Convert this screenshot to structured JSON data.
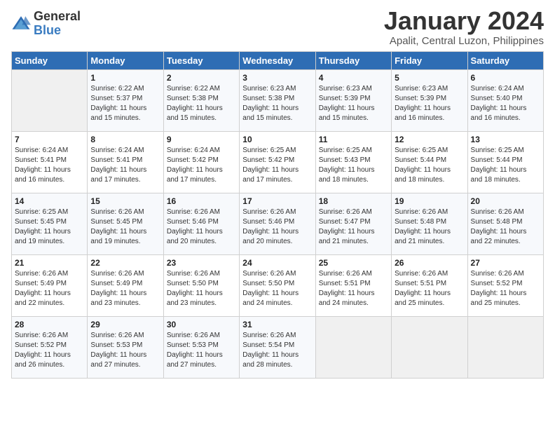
{
  "logo": {
    "general": "General",
    "blue": "Blue"
  },
  "calendar": {
    "title": "January 2024",
    "subtitle": "Apalit, Central Luzon, Philippines"
  },
  "days_of_week": [
    "Sunday",
    "Monday",
    "Tuesday",
    "Wednesday",
    "Thursday",
    "Friday",
    "Saturday"
  ],
  "weeks": [
    [
      {
        "day": "",
        "sunrise": "",
        "sunset": "",
        "daylight": ""
      },
      {
        "day": "1",
        "sunrise": "Sunrise: 6:22 AM",
        "sunset": "Sunset: 5:37 PM",
        "daylight": "Daylight: 11 hours and 15 minutes."
      },
      {
        "day": "2",
        "sunrise": "Sunrise: 6:22 AM",
        "sunset": "Sunset: 5:38 PM",
        "daylight": "Daylight: 11 hours and 15 minutes."
      },
      {
        "day": "3",
        "sunrise": "Sunrise: 6:23 AM",
        "sunset": "Sunset: 5:38 PM",
        "daylight": "Daylight: 11 hours and 15 minutes."
      },
      {
        "day": "4",
        "sunrise": "Sunrise: 6:23 AM",
        "sunset": "Sunset: 5:39 PM",
        "daylight": "Daylight: 11 hours and 15 minutes."
      },
      {
        "day": "5",
        "sunrise": "Sunrise: 6:23 AM",
        "sunset": "Sunset: 5:39 PM",
        "daylight": "Daylight: 11 hours and 16 minutes."
      },
      {
        "day": "6",
        "sunrise": "Sunrise: 6:24 AM",
        "sunset": "Sunset: 5:40 PM",
        "daylight": "Daylight: 11 hours and 16 minutes."
      }
    ],
    [
      {
        "day": "7",
        "sunrise": "Sunrise: 6:24 AM",
        "sunset": "Sunset: 5:41 PM",
        "daylight": "Daylight: 11 hours and 16 minutes."
      },
      {
        "day": "8",
        "sunrise": "Sunrise: 6:24 AM",
        "sunset": "Sunset: 5:41 PM",
        "daylight": "Daylight: 11 hours and 17 minutes."
      },
      {
        "day": "9",
        "sunrise": "Sunrise: 6:24 AM",
        "sunset": "Sunset: 5:42 PM",
        "daylight": "Daylight: 11 hours and 17 minutes."
      },
      {
        "day": "10",
        "sunrise": "Sunrise: 6:25 AM",
        "sunset": "Sunset: 5:42 PM",
        "daylight": "Daylight: 11 hours and 17 minutes."
      },
      {
        "day": "11",
        "sunrise": "Sunrise: 6:25 AM",
        "sunset": "Sunset: 5:43 PM",
        "daylight": "Daylight: 11 hours and 18 minutes."
      },
      {
        "day": "12",
        "sunrise": "Sunrise: 6:25 AM",
        "sunset": "Sunset: 5:44 PM",
        "daylight": "Daylight: 11 hours and 18 minutes."
      },
      {
        "day": "13",
        "sunrise": "Sunrise: 6:25 AM",
        "sunset": "Sunset: 5:44 PM",
        "daylight": "Daylight: 11 hours and 18 minutes."
      }
    ],
    [
      {
        "day": "14",
        "sunrise": "Sunrise: 6:25 AM",
        "sunset": "Sunset: 5:45 PM",
        "daylight": "Daylight: 11 hours and 19 minutes."
      },
      {
        "day": "15",
        "sunrise": "Sunrise: 6:26 AM",
        "sunset": "Sunset: 5:45 PM",
        "daylight": "Daylight: 11 hours and 19 minutes."
      },
      {
        "day": "16",
        "sunrise": "Sunrise: 6:26 AM",
        "sunset": "Sunset: 5:46 PM",
        "daylight": "Daylight: 11 hours and 20 minutes."
      },
      {
        "day": "17",
        "sunrise": "Sunrise: 6:26 AM",
        "sunset": "Sunset: 5:46 PM",
        "daylight": "Daylight: 11 hours and 20 minutes."
      },
      {
        "day": "18",
        "sunrise": "Sunrise: 6:26 AM",
        "sunset": "Sunset: 5:47 PM",
        "daylight": "Daylight: 11 hours and 21 minutes."
      },
      {
        "day": "19",
        "sunrise": "Sunrise: 6:26 AM",
        "sunset": "Sunset: 5:48 PM",
        "daylight": "Daylight: 11 hours and 21 minutes."
      },
      {
        "day": "20",
        "sunrise": "Sunrise: 6:26 AM",
        "sunset": "Sunset: 5:48 PM",
        "daylight": "Daylight: 11 hours and 22 minutes."
      }
    ],
    [
      {
        "day": "21",
        "sunrise": "Sunrise: 6:26 AM",
        "sunset": "Sunset: 5:49 PM",
        "daylight": "Daylight: 11 hours and 22 minutes."
      },
      {
        "day": "22",
        "sunrise": "Sunrise: 6:26 AM",
        "sunset": "Sunset: 5:49 PM",
        "daylight": "Daylight: 11 hours and 23 minutes."
      },
      {
        "day": "23",
        "sunrise": "Sunrise: 6:26 AM",
        "sunset": "Sunset: 5:50 PM",
        "daylight": "Daylight: 11 hours and 23 minutes."
      },
      {
        "day": "24",
        "sunrise": "Sunrise: 6:26 AM",
        "sunset": "Sunset: 5:50 PM",
        "daylight": "Daylight: 11 hours and 24 minutes."
      },
      {
        "day": "25",
        "sunrise": "Sunrise: 6:26 AM",
        "sunset": "Sunset: 5:51 PM",
        "daylight": "Daylight: 11 hours and 24 minutes."
      },
      {
        "day": "26",
        "sunrise": "Sunrise: 6:26 AM",
        "sunset": "Sunset: 5:51 PM",
        "daylight": "Daylight: 11 hours and 25 minutes."
      },
      {
        "day": "27",
        "sunrise": "Sunrise: 6:26 AM",
        "sunset": "Sunset: 5:52 PM",
        "daylight": "Daylight: 11 hours and 25 minutes."
      }
    ],
    [
      {
        "day": "28",
        "sunrise": "Sunrise: 6:26 AM",
        "sunset": "Sunset: 5:52 PM",
        "daylight": "Daylight: 11 hours and 26 minutes."
      },
      {
        "day": "29",
        "sunrise": "Sunrise: 6:26 AM",
        "sunset": "Sunset: 5:53 PM",
        "daylight": "Daylight: 11 hours and 27 minutes."
      },
      {
        "day": "30",
        "sunrise": "Sunrise: 6:26 AM",
        "sunset": "Sunset: 5:53 PM",
        "daylight": "Daylight: 11 hours and 27 minutes."
      },
      {
        "day": "31",
        "sunrise": "Sunrise: 6:26 AM",
        "sunset": "Sunset: 5:54 PM",
        "daylight": "Daylight: 11 hours and 28 minutes."
      },
      {
        "day": "",
        "sunrise": "",
        "sunset": "",
        "daylight": ""
      },
      {
        "day": "",
        "sunrise": "",
        "sunset": "",
        "daylight": ""
      },
      {
        "day": "",
        "sunrise": "",
        "sunset": "",
        "daylight": ""
      }
    ]
  ]
}
